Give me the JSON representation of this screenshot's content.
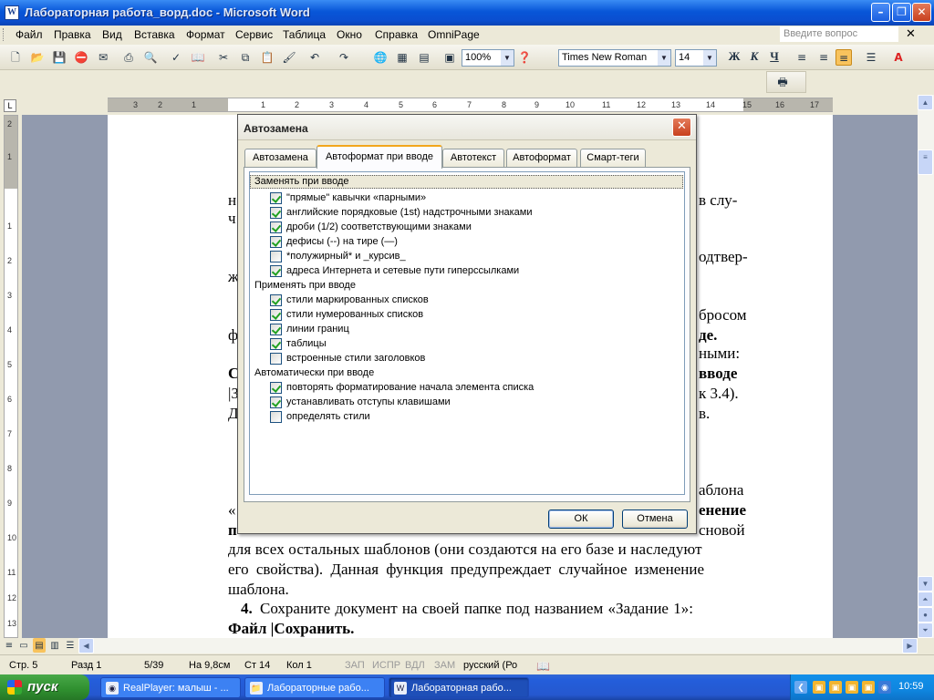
{
  "window": {
    "title": "Лабораторная работа_ворд.doc - Microsoft Word"
  },
  "menubar": {
    "items": [
      "Файл",
      "Правка",
      "Вид",
      "Вставка",
      "Формат",
      "Сервис",
      "Таблица",
      "Окно",
      "Справка",
      "OmniPage"
    ],
    "ask_placeholder": "Введите вопрос"
  },
  "toolbar": {
    "zoom": "100%",
    "font": "Times New Roman",
    "size": "14"
  },
  "ruler": {
    "ticks": [
      "3",
      "2",
      "1",
      "1",
      "2",
      "3",
      "4",
      "5",
      "6",
      "7",
      "8",
      "9",
      "10",
      "11",
      "12",
      "13",
      "14",
      "15",
      "16",
      "17"
    ]
  },
  "vruler": {
    "ticks": [
      "2",
      "1",
      "1",
      "2",
      "3",
      "4",
      "5",
      "6",
      "7",
      "8",
      "9",
      "10",
      "11",
      "12",
      "13"
    ]
  },
  "document": {
    "lines_right": [
      "в слу-",
      "одтвер-",
      "бросом",
      "де.",
      "ными:",
      "вводе",
      "к 3.4).",
      "в.",
      "аблона",
      "енение",
      "сновой"
    ],
    "lines_left": [
      "н",
      "ч",
      "ж",
      "ф",
      "С",
      "|З",
      "Д",
      "«",
      "п"
    ],
    "para1_l1": "для всех остальных шаблонов (они создаются на его базе и наследуют",
    "para1_l2": "его свойства). Данная функция предупреждает случайное изменение",
    "para1_l3": "шаблона.",
    "step_num": "4.",
    "step_text": "Сохраните документ на своей папке под названием «Задание 1»:",
    "step_path": "Файл |Сохранить."
  },
  "dialog": {
    "title": "Автозамена",
    "tabs": [
      "Автозамена",
      "Автоформат при вводе",
      "Автотекст",
      "Автоформат",
      "Смарт-теги"
    ],
    "groups": [
      {
        "title": "Заменять при вводе",
        "options": [
          {
            "label": "\"прямые\" кавычки «парными»",
            "checked": true
          },
          {
            "label": "английские порядковые (1st) надстрочными знаками",
            "checked": true
          },
          {
            "label": "дроби (1/2) соответствующими знаками",
            "checked": true
          },
          {
            "label": "дефисы (--) на тире (—)",
            "checked": true
          },
          {
            "label": "*полужирный* и _курсив_",
            "checked": false
          },
          {
            "label": "адреса Интернета и сетевые пути гиперссылками",
            "checked": true
          }
        ]
      },
      {
        "title": "Применять при вводе",
        "options": [
          {
            "label": "стили маркированных списков",
            "checked": true
          },
          {
            "label": "стили нумерованных списков",
            "checked": true
          },
          {
            "label": "линии границ",
            "checked": true
          },
          {
            "label": "таблицы",
            "checked": true
          },
          {
            "label": "встроенные стили заголовков",
            "checked": false
          }
        ]
      },
      {
        "title": "Автоматически при вводе",
        "options": [
          {
            "label": "повторять форматирование начала элемента списка",
            "checked": true
          },
          {
            "label": "устанавливать отступы клавишами",
            "checked": true
          },
          {
            "label": "определять стили",
            "checked": false
          }
        ]
      }
    ],
    "ok_label": "ОК",
    "cancel_label": "Отмена"
  },
  "statusbar": {
    "page": "Стр. 5",
    "section": "Разд 1",
    "pages": "5/39",
    "pos": "На 9,8см",
    "line": "Ст 14",
    "col": "Кол 1",
    "rec": "ЗАП",
    "trk": "ИСПР",
    "ext": "ВДЛ",
    "ovr": "ЗАМ",
    "lang": "русский (Ро"
  },
  "taskbar": {
    "start_label": "пуск",
    "tasks": [
      "RealPlayer: малыш - ...",
      "Лабораторные рабо...",
      "Лабораторная рабо..."
    ],
    "clock": "10:59"
  }
}
